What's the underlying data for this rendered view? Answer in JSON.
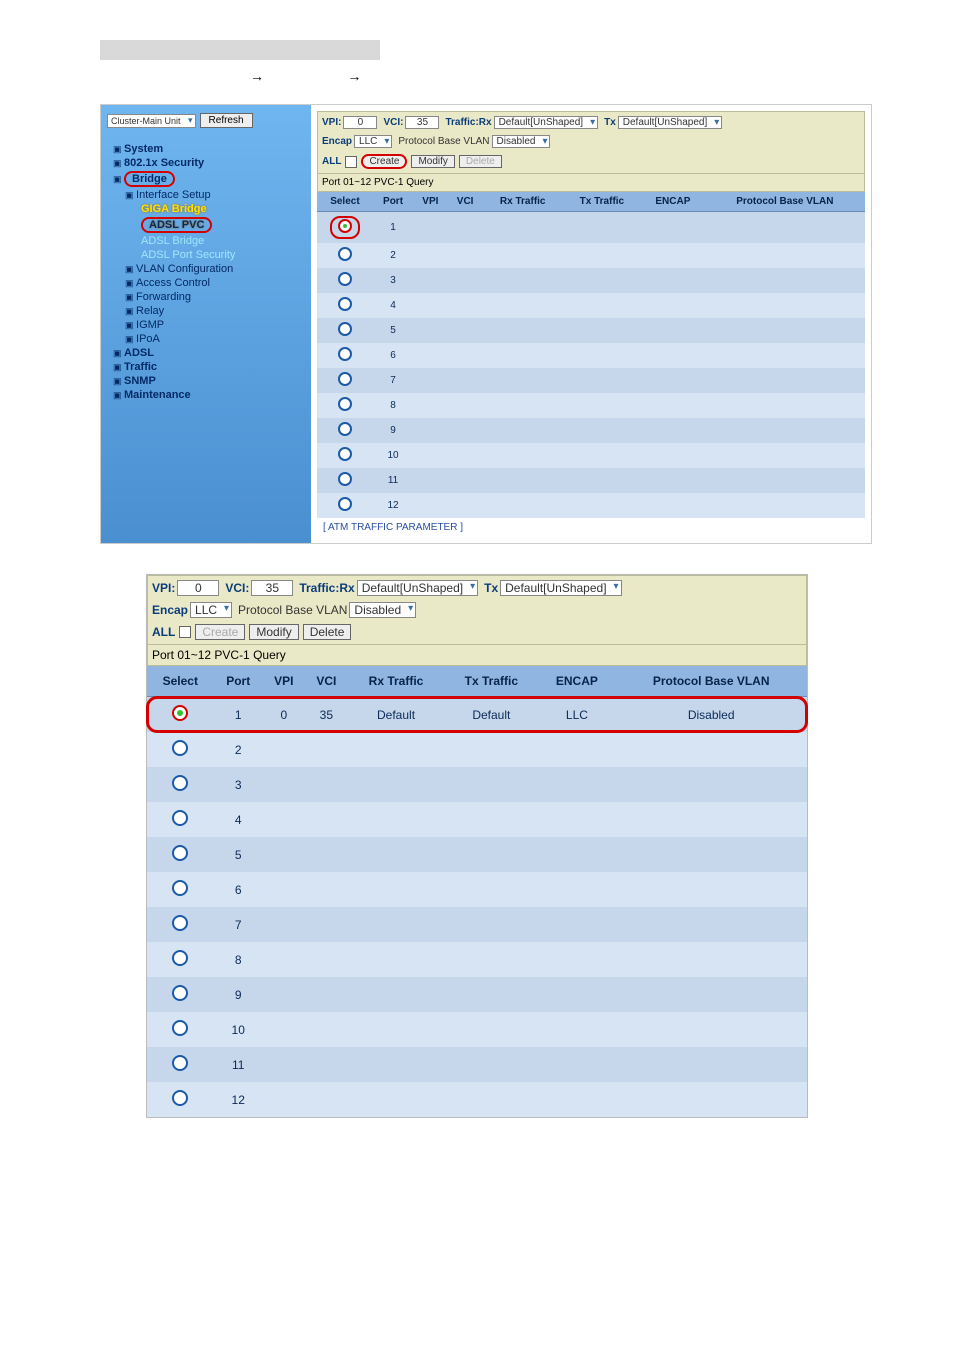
{
  "breadcrumb": {
    "a": "",
    "b": ""
  },
  "sidebar": {
    "cluster_select": "Cluster-Main Unit",
    "refresh": "Refresh",
    "items": [
      {
        "label": "System",
        "cls": "lvl1 open"
      },
      {
        "label": "802.1x Security",
        "cls": "lvl1 open"
      },
      {
        "label": "Bridge",
        "cls": "lvl1 open",
        "ring": true
      },
      {
        "label": "Interface Setup",
        "cls": "lvl2"
      },
      {
        "label": "GIGA Bridge",
        "cls": "lvl3 yellow"
      },
      {
        "label": "ADSL PVC",
        "cls": "lvl3 yellow",
        "ring": true
      },
      {
        "label": "ADSL Bridge",
        "cls": "lvl3 cyan"
      },
      {
        "label": "ADSL Port Security",
        "cls": "lvl3 cyan"
      },
      {
        "label": "VLAN Configuration",
        "cls": "lvl2"
      },
      {
        "label": "Access Control",
        "cls": "lvl2"
      },
      {
        "label": "Forwarding",
        "cls": "lvl2"
      },
      {
        "label": "Relay",
        "cls": "lvl2"
      },
      {
        "label": "IGMP",
        "cls": "lvl2"
      },
      {
        "label": "IPoA",
        "cls": "lvl2"
      },
      {
        "label": "ADSL",
        "cls": "lvl1 closed"
      },
      {
        "label": "Traffic",
        "cls": "lvl1 closed"
      },
      {
        "label": "SNMP",
        "cls": "lvl1 closed"
      },
      {
        "label": "Maintenance",
        "cls": "lvl1 closed"
      }
    ]
  },
  "form": {
    "vpi_label": "VPI:",
    "vpi_value": "0",
    "vci_label": "VCI:",
    "vci_value": "35",
    "traffic_rx_label": "Traffic:Rx",
    "traffic_rx_value": "Default[UnShaped]",
    "tx_label": "Tx",
    "tx_value": "Default[UnShaped]",
    "encap_label": "Encap",
    "encap_value": "LLC",
    "pbv_label": "Protocol Base VLAN",
    "pbv_value": "Disabled",
    "all_label": "ALL",
    "btn_create": "Create",
    "btn_modify": "Modify",
    "btn_delete": "Delete",
    "port_select": "Port 01~12",
    "pvc_select": "PVC-1",
    "btn_query": "Query"
  },
  "columns": {
    "select": "Select",
    "port": "Port",
    "vpi": "VPI",
    "vci": "VCI",
    "rx": "Rx Traffic",
    "tx": "Tx Traffic",
    "encap": "ENCAP",
    "pbv": "Protocol Base VLAN"
  },
  "upper_rows": [
    {
      "port": "1",
      "selected": true
    },
    {
      "port": "2"
    },
    {
      "port": "3"
    },
    {
      "port": "4"
    },
    {
      "port": "5"
    },
    {
      "port": "6"
    },
    {
      "port": "7"
    },
    {
      "port": "8"
    },
    {
      "port": "9"
    },
    {
      "port": "10"
    },
    {
      "port": "11"
    },
    {
      "port": "12"
    }
  ],
  "atm_link": "[ ATM TRAFFIC PARAMETER ]",
  "lower_rows": [
    {
      "port": "1",
      "selected": true,
      "vpi": "0",
      "vci": "35",
      "rx": "Default",
      "tx": "Default",
      "encap": "LLC",
      "pbv": "Disabled"
    },
    {
      "port": "2"
    },
    {
      "port": "3"
    },
    {
      "port": "4"
    },
    {
      "port": "5"
    },
    {
      "port": "6"
    },
    {
      "port": "7"
    },
    {
      "port": "8"
    },
    {
      "port": "9"
    },
    {
      "port": "10"
    },
    {
      "port": "11"
    },
    {
      "port": "12"
    }
  ]
}
